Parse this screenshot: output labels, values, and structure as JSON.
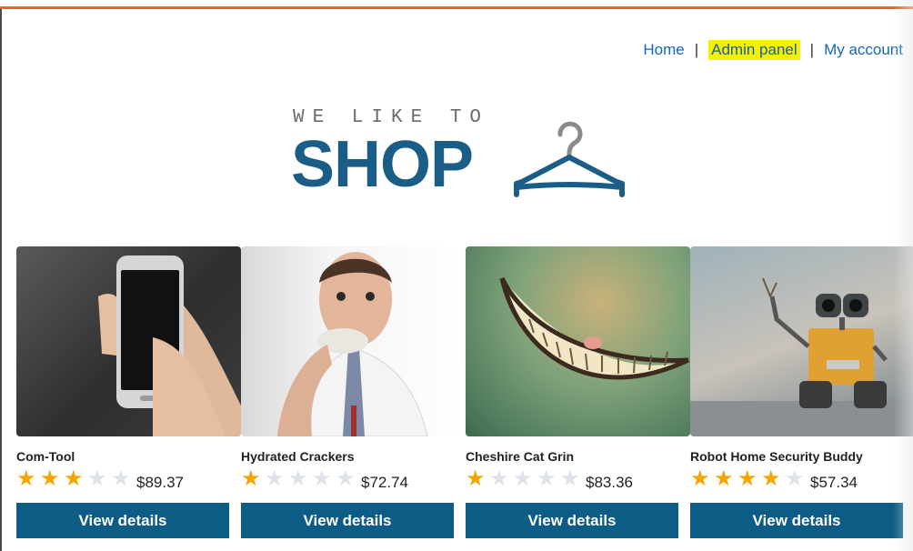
{
  "nav": {
    "home": "Home",
    "admin_panel": "Admin panel",
    "my_account": "My account",
    "separator": "|"
  },
  "logo": {
    "tagline": "WE LIKE TO",
    "word": "SHOP",
    "icon": "hanger-icon"
  },
  "colors": {
    "accent_bar": "#e8642c",
    "brand_blue": "#1a5e87",
    "button_bg": "#0d5c85",
    "star_on": "#f5a500",
    "highlight": "#f3f000"
  },
  "products": [
    {
      "name": "Com-Tool",
      "rating": 3,
      "price": "$89.37",
      "button": "View details",
      "image": "phone-in-hand-image"
    },
    {
      "name": "Hydrated Crackers",
      "rating": 1,
      "price": "$72.74",
      "button": "View details",
      "image": "man-eating-cracker-image"
    },
    {
      "name": "Cheshire Cat Grin",
      "rating": 1,
      "price": "$83.36",
      "button": "View details",
      "image": "cheshire-grin-image"
    },
    {
      "name": "Robot Home Security Buddy",
      "rating": 4,
      "price": "$57.34",
      "button": "View details",
      "image": "toy-robot-image"
    }
  ],
  "rating_max": 5
}
